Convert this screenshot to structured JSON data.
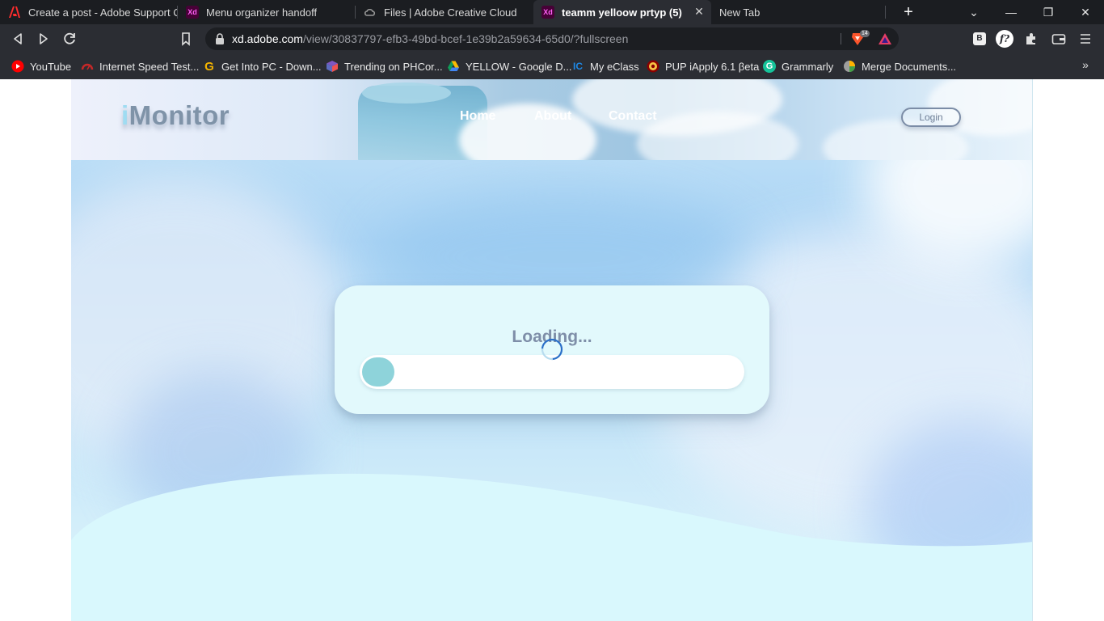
{
  "browser": {
    "tabs": [
      {
        "title": "Create a post - Adobe Support Community",
        "icon": "adobe-icon",
        "active": false
      },
      {
        "title": "Menu organizer handoff",
        "icon": "xd-icon",
        "active": false
      },
      {
        "title": "Files | Adobe Creative Cloud",
        "icon": "creative-cloud-icon",
        "active": false
      },
      {
        "title": "teamm yelloow prtyp (5)",
        "icon": "xd-icon",
        "active": true
      },
      {
        "title": "New Tab",
        "icon": "",
        "active": false
      }
    ],
    "favicon_text": {
      "xd": "Xd"
    },
    "url_host": "xd.adobe.com",
    "url_path": "/view/30837797-efb3-49bd-bcef-1e39b2a59634-65d0/?fullscreen",
    "brave_shield_count": "14",
    "extension_b_label": "B",
    "extension_f_label": "f?",
    "bookmarks": [
      {
        "label": "YouTube",
        "icon": "youtube-icon"
      },
      {
        "label": "Internet Speed Test...",
        "icon": "speedometer-icon"
      },
      {
        "label": "Get Into PC - Down...",
        "icon": "g-logo-icon"
      },
      {
        "label": "Trending on PHCor...",
        "icon": "cube-icon"
      },
      {
        "label": "YELLOW - Google D...",
        "icon": "google-drive-icon"
      },
      {
        "label": "My eClass",
        "icon": "eclass-icon"
      },
      {
        "label": "PUP iApply 6.1 βeta",
        "icon": "pup-seal-icon"
      },
      {
        "label": "Grammarly",
        "icon": "grammarly-icon"
      },
      {
        "label": "Merge Documents...",
        "icon": "merge-icon"
      }
    ],
    "bookmark_glyphs": {
      "get_into_pc": "G",
      "eclass": "IC",
      "grammarly": "G"
    }
  },
  "page": {
    "logo_prefix": "i",
    "logo_rest": "Monitor",
    "nav": [
      "Home",
      "About",
      "Contact"
    ],
    "login_label": "Login",
    "loading_text": "Loading...",
    "progress": 0.085
  },
  "colors": {
    "accent_teal": "#8ed3da",
    "nav_text": "#ffffff",
    "muted_text": "#7e8ea8",
    "spinner": "#2a6fc8"
  }
}
